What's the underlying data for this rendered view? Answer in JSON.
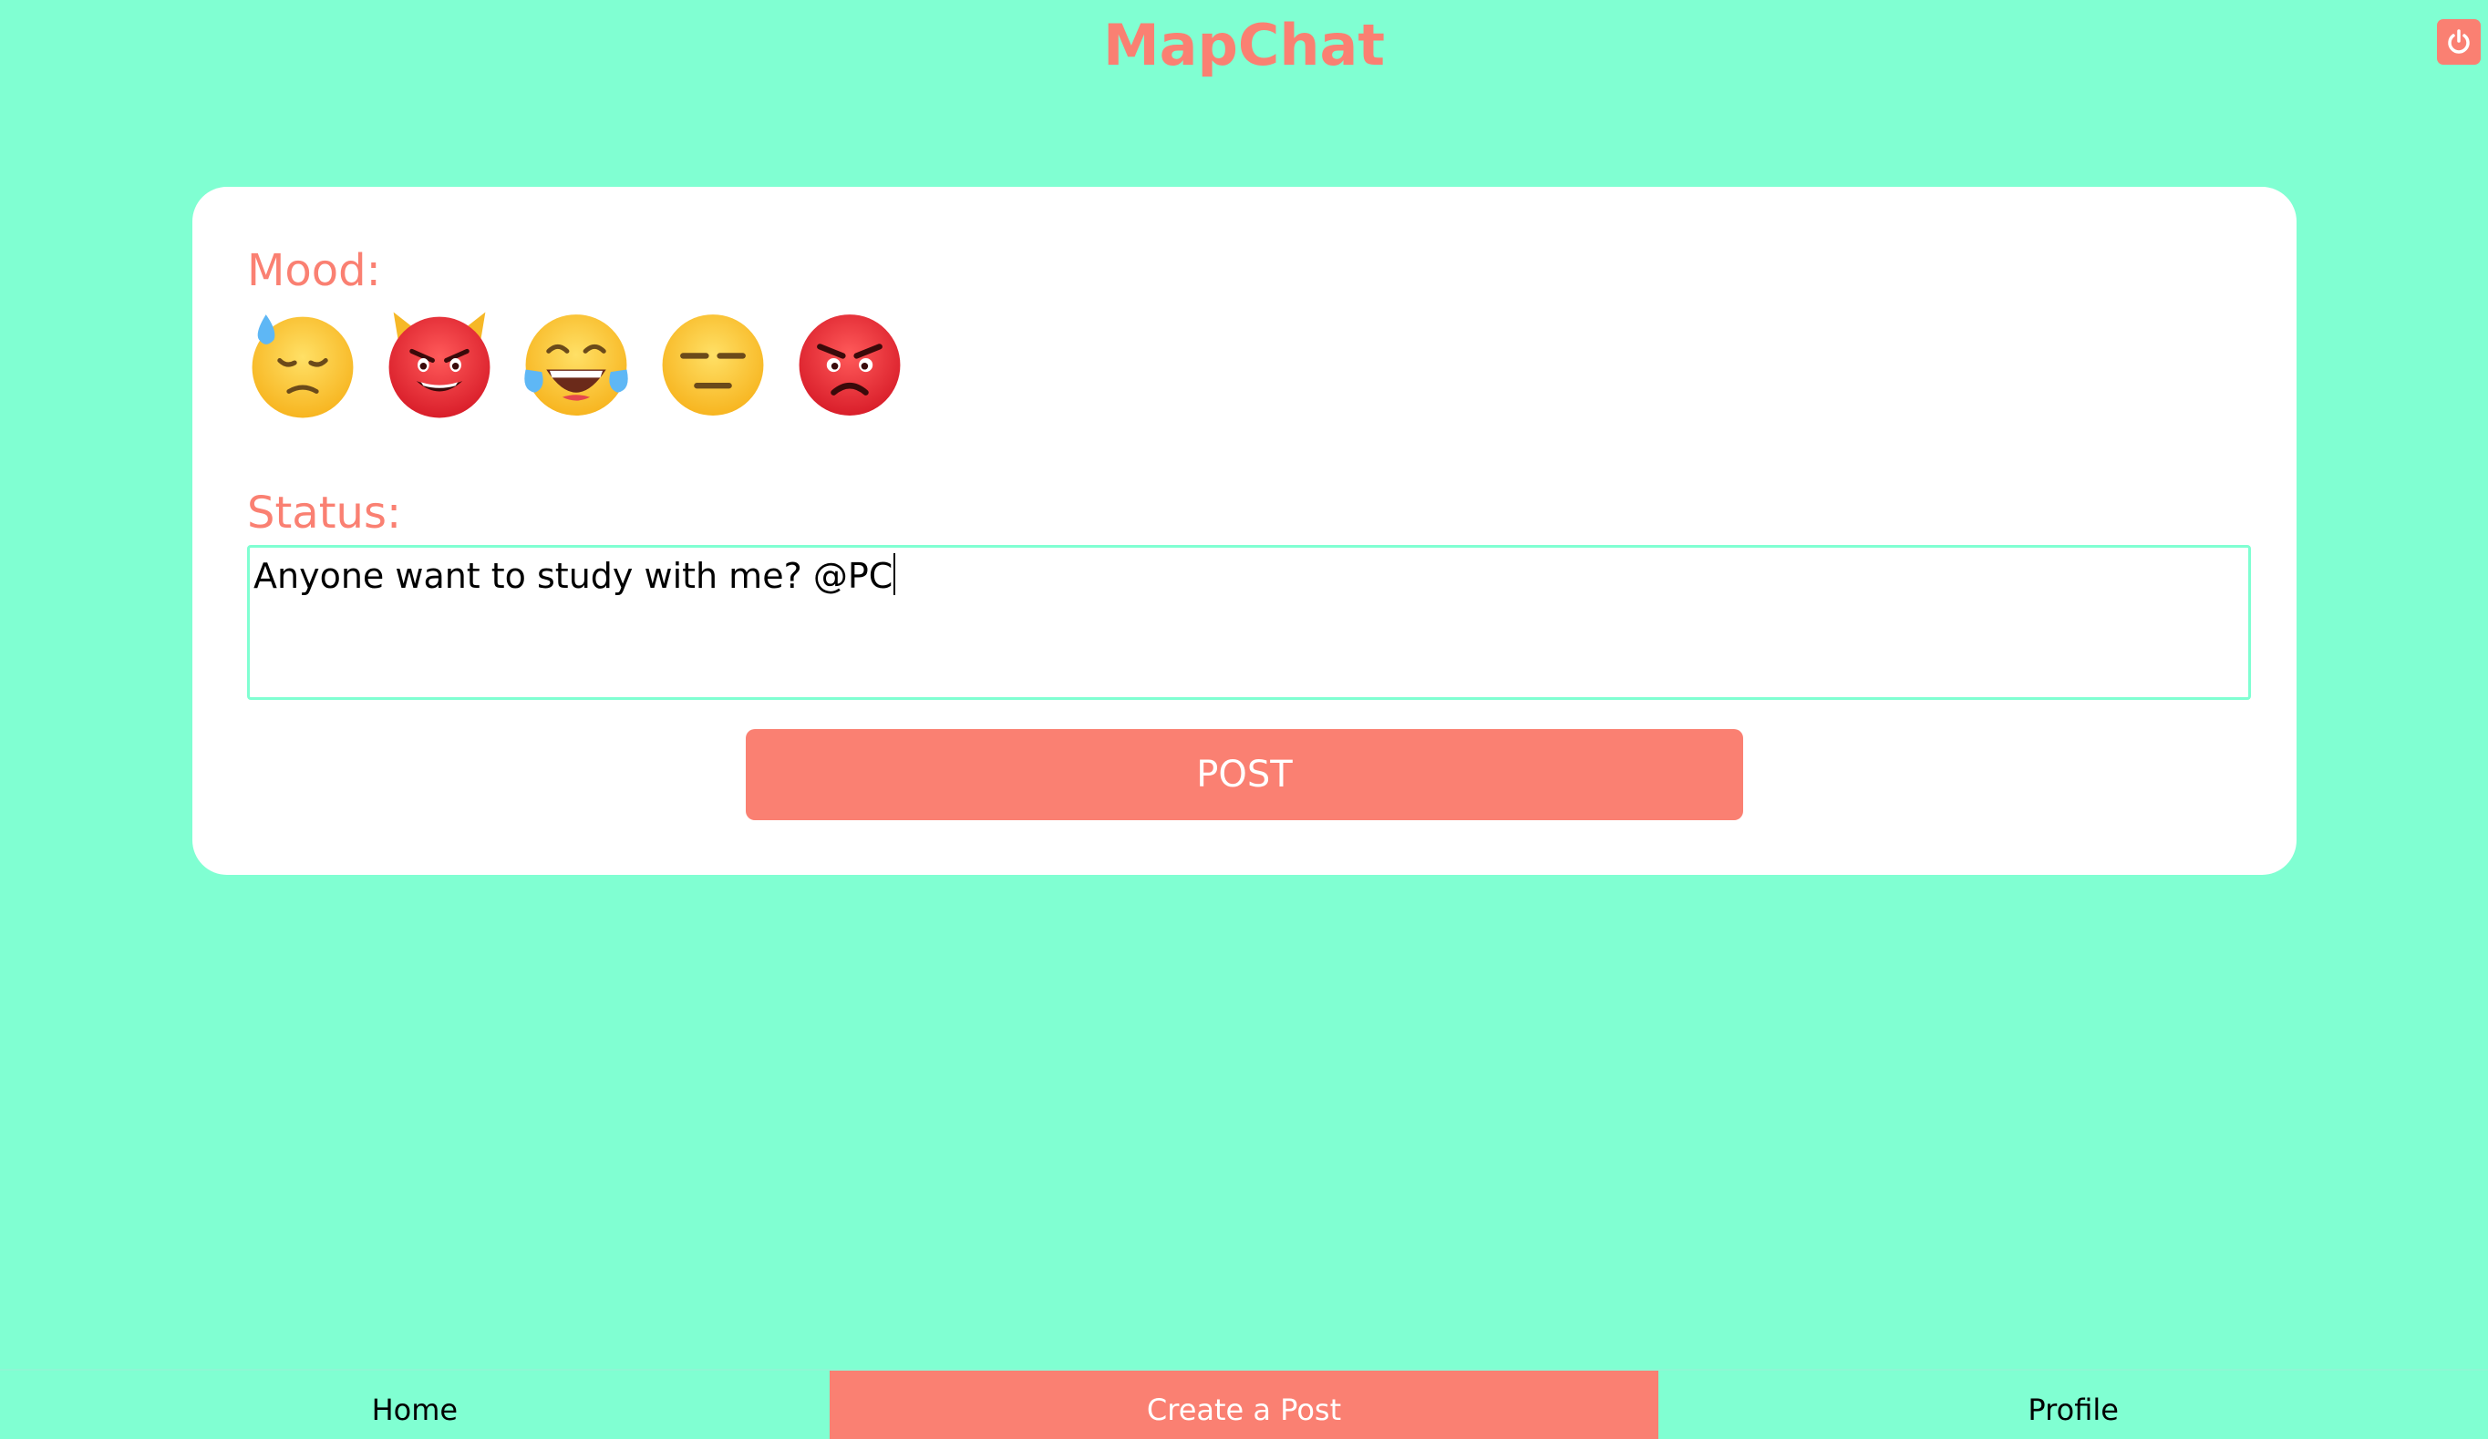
{
  "header": {
    "title": "MapChat",
    "power_icon": "power-icon"
  },
  "form": {
    "mood_label": "Mood:",
    "moods": [
      {
        "name": "sad-sweat-emoji"
      },
      {
        "name": "devil-emoji"
      },
      {
        "name": "laughing-tears-emoji"
      },
      {
        "name": "expressionless-emoji"
      },
      {
        "name": "angry-emoji"
      }
    ],
    "status_label": "Status:",
    "status_value": "Anyone want to study with me? @PC",
    "post_label": "POST"
  },
  "nav": {
    "items": [
      {
        "label": "Home"
      },
      {
        "label": "Create a Post"
      },
      {
        "label": "Profile"
      }
    ],
    "active": "Create a Post"
  },
  "colors": {
    "background": "#80ffd2",
    "accent": "#fa8072",
    "card": "#ffffff"
  }
}
